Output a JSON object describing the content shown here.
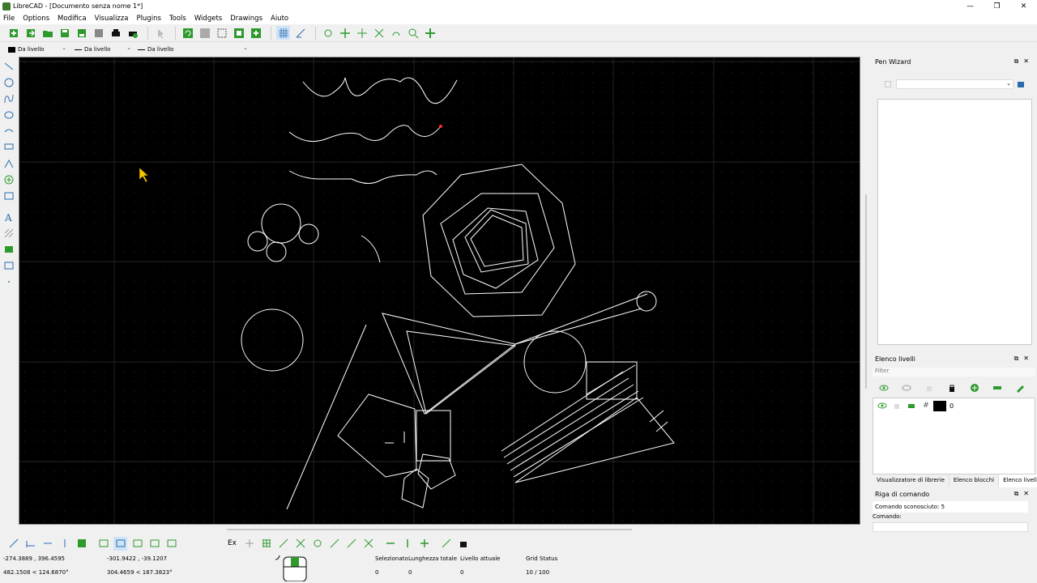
{
  "window": {
    "title": "LibreCAD - [Documento senza nome 1*]"
  },
  "menu": [
    "File",
    "Options",
    "Modifica",
    "Visualizza",
    "Plugins",
    "Tools",
    "Widgets",
    "Drawings",
    "Aiuto"
  ],
  "properties": {
    "color": "Da livello",
    "width": "Da livello",
    "linetype": "Da livello"
  },
  "panels": {
    "pen_wizard": {
      "title": "Pen Wizard"
    },
    "layers": {
      "title": "Elenco livelli",
      "filter_placeholder": "Filter",
      "rows": [
        {
          "name": "0",
          "color": "#000000"
        }
      ]
    },
    "tabs": [
      "Visualizzatore di librerie",
      "Elenco blocchi",
      "Elenco livelli"
    ],
    "command_line": {
      "title": "Riga di comando",
      "output": "Comando sconosciuto: 5",
      "prompt": "Comando:"
    }
  },
  "bottom_toolbar": {
    "ex_label": "Ex"
  },
  "status": {
    "abs_coord": "-274.3889 , 396.4595",
    "abs_polar": "482.1508 < 124.6870°",
    "rel_coord": "-301.9422 , -39.1207",
    "rel_polar": "304.4659 < 187.3823°",
    "selected_label": "Selezionato",
    "selected_value": "0",
    "total_length_label": "Lunghezza totale",
    "total_length_value": "0",
    "current_layer_label": "Livello attuale",
    "current_layer_value": "0",
    "grid_label": "Grid Status",
    "grid_value": "10 / 100"
  },
  "colors": {
    "canvas_bg": "#000000",
    "drawing": "#ffffff",
    "grid": "#333333",
    "accent_green": "#2e9a2e",
    "cursor": "#f5c400"
  }
}
